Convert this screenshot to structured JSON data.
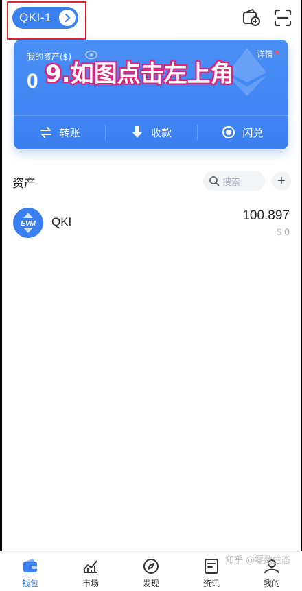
{
  "header": {
    "wallet_name": "QKI-1"
  },
  "asset_card": {
    "label": "我的资产($)",
    "details_link": "详情",
    "total": "0",
    "actions": [
      {
        "label": "转账",
        "icon": "transfer-icon"
      },
      {
        "label": "收款",
        "icon": "receive-icon"
      },
      {
        "label": "闪兑",
        "icon": "swap-icon"
      }
    ]
  },
  "annotation": "9.如图点击左上角",
  "assets": {
    "title": "资产",
    "search_placeholder": "搜索",
    "add_label": "+",
    "tokens": [
      {
        "name": "QKI",
        "logo_text": "EVM",
        "balance": "100.897",
        "value": "$ 0"
      }
    ]
  },
  "bottom_nav": [
    {
      "label": "钱包",
      "icon": "wallet-icon",
      "active": true
    },
    {
      "label": "市场",
      "icon": "market-chart-icon",
      "active": false
    },
    {
      "label": "发现",
      "icon": "compass-icon",
      "active": false
    },
    {
      "label": "资讯",
      "icon": "news-icon",
      "active": false
    },
    {
      "label": "我的",
      "icon": "profile-icon",
      "active": false
    }
  ],
  "watermark": "知乎 @零数生态",
  "colors": {
    "accent": "#3b7ff0",
    "highlight_border": "#e0242b",
    "annotation_outline": "#e0247a"
  }
}
